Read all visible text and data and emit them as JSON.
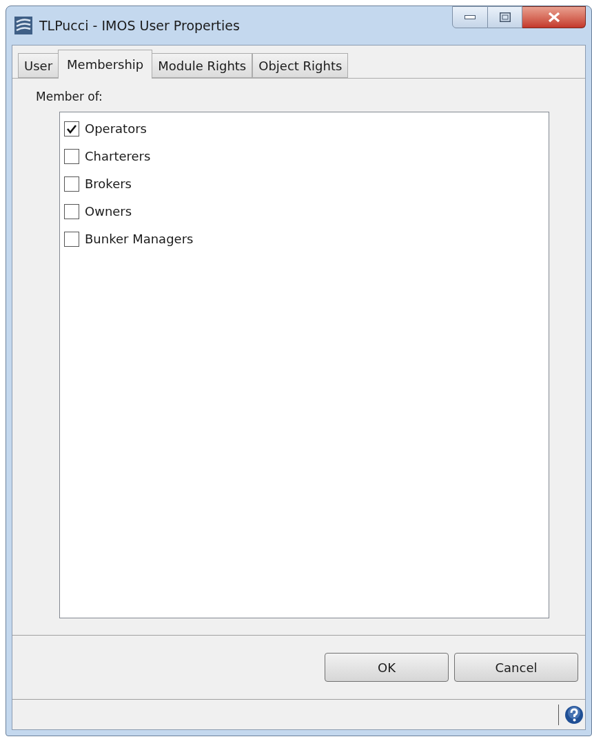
{
  "window": {
    "title": "TLPucci - IMOS User Properties"
  },
  "tabs": [
    {
      "label": "User",
      "selected": false
    },
    {
      "label": "Membership",
      "selected": true
    },
    {
      "label": "Module Rights",
      "selected": false
    },
    {
      "label": "Object Rights",
      "selected": false
    }
  ],
  "membership": {
    "label": "Member of:",
    "groups": [
      {
        "label": "Operators",
        "checked": true
      },
      {
        "label": "Charterers",
        "checked": false
      },
      {
        "label": "Brokers",
        "checked": false
      },
      {
        "label": "Owners",
        "checked": false
      },
      {
        "label": "Bunker Managers",
        "checked": false
      }
    ]
  },
  "buttons": [
    {
      "label": "OK"
    },
    {
      "label": "Cancel"
    }
  ]
}
